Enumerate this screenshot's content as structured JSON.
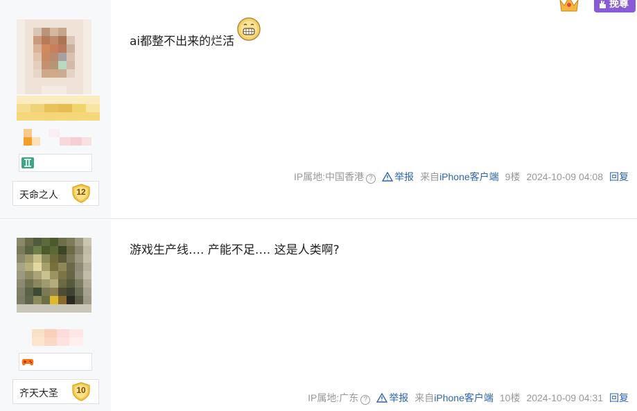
{
  "posts": [
    {
      "level_title": "天命之人",
      "level": "12",
      "content": "ai都整不出来的烂活",
      "emoji": "smile-emoji",
      "ip": "IP属地:中国香港",
      "report": "举报",
      "client_prefix": "来自",
      "client": "iPhone客户端",
      "floor": "9楼",
      "time": "2024-10-09 04:08",
      "reply": "回复"
    },
    {
      "level_title": "齐天大圣",
      "level": "10",
      "content": "游戏生产线…. 产能不足…. 这是人类啊?",
      "ip": "IP属地:广东",
      "report": "举报",
      "client_prefix": "来自",
      "client": "iPhone客户端",
      "floor": "10楼",
      "time": "2024-10-09 04:31",
      "reply": "回复"
    }
  ],
  "top_button": "挽尊",
  "colors": {
    "link": "#2d64b3",
    "meta": "#999999",
    "accent_purple": "#8a5bd8",
    "badge_gold": "#f2c94c"
  },
  "icons": {
    "gemini": "gemini-sign-icon",
    "gamepad": "gamepad-icon",
    "warning": "warning-icon",
    "help": "question-icon"
  }
}
